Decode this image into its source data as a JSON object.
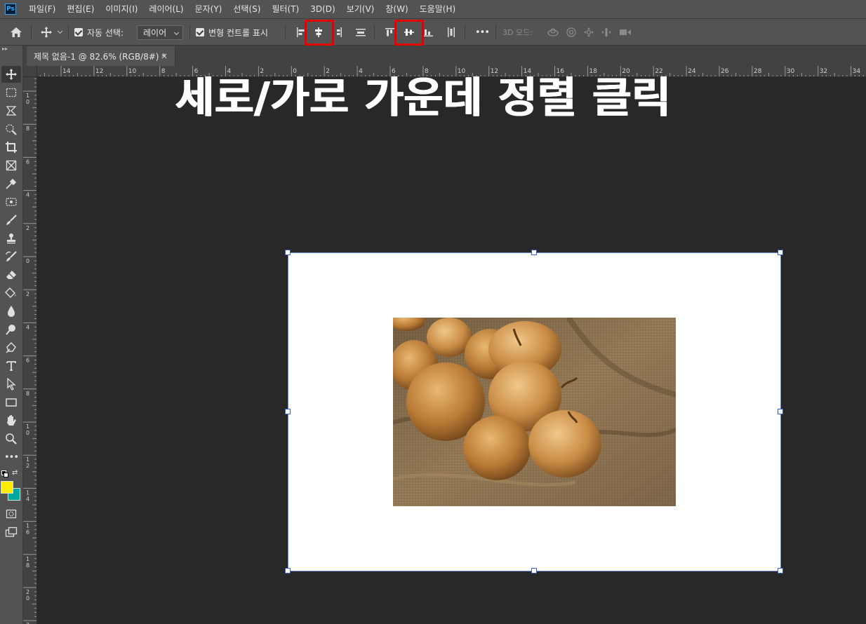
{
  "app": {
    "logo_text": "Ps"
  },
  "menu": [
    "파일(F)",
    "편집(E)",
    "이미지(I)",
    "레이어(L)",
    "문자(Y)",
    "선택(S)",
    "필터(T)",
    "3D(D)",
    "보기(V)",
    "창(W)",
    "도움말(H)"
  ],
  "options": {
    "auto_select_label": "자동 선택:",
    "auto_select_value": "레이어",
    "transform_controls_label": "변형 컨트롤 표시",
    "mode_3d_label": "3D 모드:",
    "more_label": "•••"
  },
  "document": {
    "tab_title": "제목 없음-1 @ 82.6% (RGB/8#) *",
    "close_glyph": "×"
  },
  "annotation": {
    "text": "세로/가로 가운데 정렬 클릭"
  },
  "ruler": {
    "top_labels": [
      "14",
      "12",
      "10",
      "8",
      "6",
      "4",
      "2",
      "0",
      "2",
      "4",
      "6",
      "8",
      "10",
      "12",
      "14",
      "16",
      "18",
      "20",
      "22",
      "24",
      "26",
      "28",
      "30",
      "32",
      "34"
    ],
    "left_labels": [
      "10",
      "8",
      "6",
      "4",
      "2",
      "0",
      "2",
      "4",
      "6",
      "8",
      "10",
      "12",
      "14",
      "16",
      "18",
      "20",
      "22"
    ]
  },
  "colors": {
    "foreground": "#ffee00",
    "background": "#00a99d",
    "highlight": "#e80000",
    "ui_panel": "#535353",
    "workspace": "#282828"
  },
  "icons": {
    "toolbar": [
      "move-icon",
      "marquee-icon",
      "lasso-icon",
      "quick-select-icon",
      "crop-icon",
      "frame-icon",
      "eyedropper-icon",
      "healing-brush-icon",
      "brush-icon",
      "stamp-icon",
      "history-brush-icon",
      "eraser-icon",
      "paint-bucket-icon",
      "blur-icon",
      "dodge-icon",
      "pen-icon",
      "type-icon",
      "path-select-icon",
      "rectangle-icon",
      "hand-icon",
      "zoom-icon",
      "more-tools-icon"
    ]
  }
}
